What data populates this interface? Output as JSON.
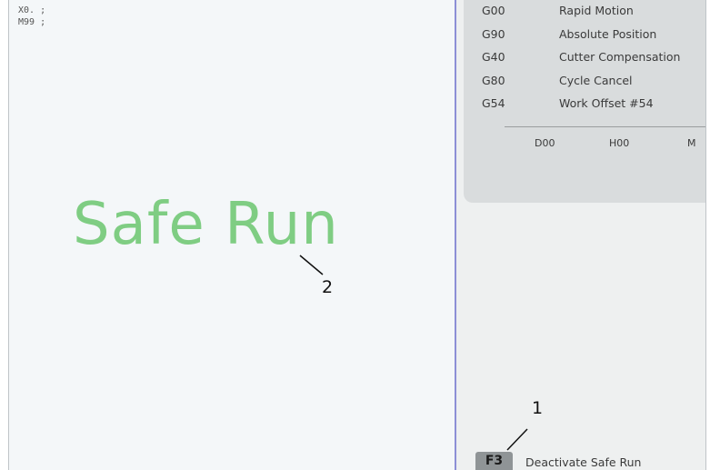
{
  "program": {
    "lines": [
      "X0. ;",
      "M99 ;"
    ]
  },
  "safe_run": {
    "label": "Safe Run"
  },
  "modal_codes": [
    {
      "code": "G00",
      "description": "Rapid Motion"
    },
    {
      "code": "G90",
      "description": "Absolute Position"
    },
    {
      "code": "G40",
      "description": "Cutter Compensation"
    },
    {
      "code": "G80",
      "description": "Cycle Cancel"
    },
    {
      "code": "G54",
      "description": "Work Offset #54"
    }
  ],
  "offsets": [
    "D00",
    "H00",
    "M"
  ],
  "softkey": {
    "key": "F3",
    "label": "Deactivate Safe Run"
  },
  "callouts": [
    "1",
    "2"
  ],
  "colors": {
    "safe_run_text": "#7fcd83",
    "divider": "#8c8fd6",
    "panel": "#d9dcdd",
    "key": "#8f9496"
  }
}
